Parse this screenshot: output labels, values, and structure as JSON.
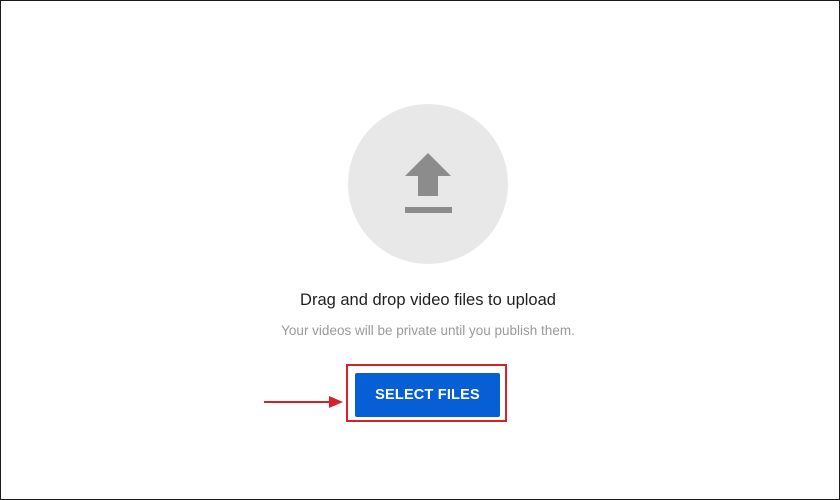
{
  "upload": {
    "icon": "upload-arrow-icon",
    "title": "Drag and drop video files to upload",
    "subtitle": "Your videos will be private until you publish them.",
    "select_button_label": "SELECT FILES"
  },
  "colors": {
    "circle_bg": "#e8e8e8",
    "icon_gray": "#8c8c8c",
    "button_blue": "#065fd4",
    "highlight_red": "#d6202a"
  }
}
